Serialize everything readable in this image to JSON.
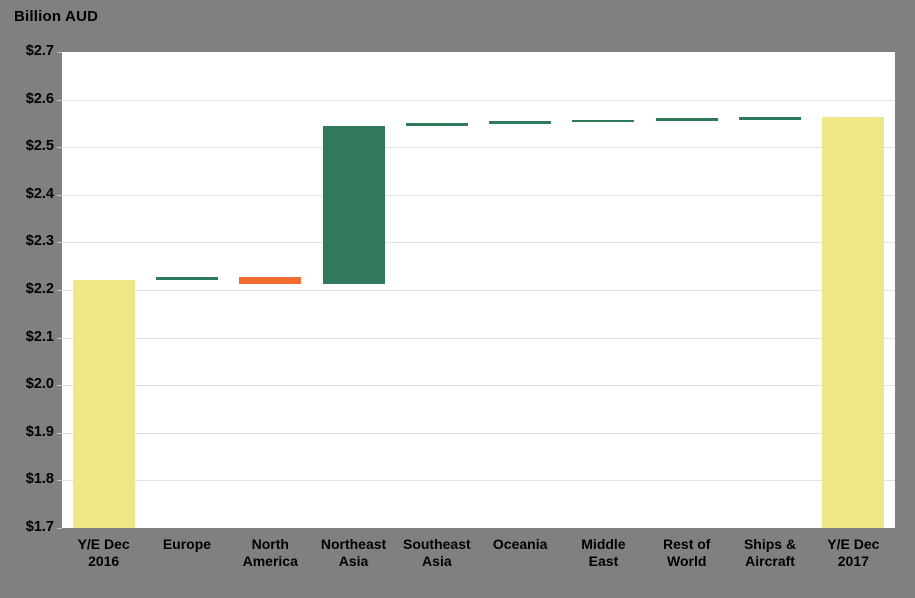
{
  "chart_data": {
    "type": "bar",
    "subtype": "waterfall",
    "title": "Billion AUD",
    "xlabel": "",
    "ylabel": "Billion AUD",
    "ylim": [
      1.7,
      2.7
    ],
    "ytick_step": 0.1,
    "grid": true,
    "legend": "none",
    "currency_prefix": "$",
    "categories": [
      "Y/E Dec\n2016",
      "Europe",
      "North\nAmerica",
      "Northeast\nAsia",
      "Southeast\nAsia",
      "Oceania",
      "Middle\nEast",
      "Rest of\nWorld",
      "Ships &\nAircraft",
      "Y/E Dec\n2017"
    ],
    "ytick_labels": [
      "$2.7",
      "$2.6",
      "$2.5",
      "$2.4",
      "$2.3",
      "$2.2",
      "$2.1",
      "$2.0",
      "$1.9",
      "$1.8",
      "$1.7"
    ],
    "ytick_values": [
      2.7,
      2.6,
      2.5,
      2.4,
      2.3,
      2.2,
      2.1,
      2.0,
      1.9,
      1.8,
      1.7
    ],
    "bars": [
      {
        "label": "Y/E Dec 2016",
        "kind": "total",
        "base": 1.7,
        "top": 2.22,
        "value": 2.22,
        "color": "#eee786"
      },
      {
        "label": "Europe",
        "kind": "increase",
        "base": 2.22,
        "top": 2.228,
        "value": 0.008,
        "color": "#31795c"
      },
      {
        "label": "North America",
        "kind": "decrease",
        "base": 2.228,
        "top": 2.212,
        "value": -0.016,
        "color": "#f26b31"
      },
      {
        "label": "Northeast Asia",
        "kind": "increase",
        "base": 2.212,
        "top": 2.545,
        "value": 0.333,
        "color": "#31795c"
      },
      {
        "label": "Southeast Asia",
        "kind": "increase",
        "base": 2.545,
        "top": 2.55,
        "value": 0.005,
        "color": "#31795c"
      },
      {
        "label": "Oceania",
        "kind": "increase",
        "base": 2.55,
        "top": 2.554,
        "value": 0.004,
        "color": "#31795c"
      },
      {
        "label": "Middle East",
        "kind": "increase",
        "base": 2.554,
        "top": 2.558,
        "value": 0.004,
        "color": "#31795c"
      },
      {
        "label": "Rest of World",
        "kind": "increase",
        "base": 2.558,
        "top": 2.561,
        "value": 0.003,
        "color": "#31795c"
      },
      {
        "label": "Ships & Aircraft",
        "kind": "increase",
        "base": 2.561,
        "top": 2.563,
        "value": 0.002,
        "color": "#31795c"
      },
      {
        "label": "Y/E Dec 2017",
        "kind": "total",
        "base": 1.7,
        "top": 2.563,
        "value": 2.563,
        "color": "#eee786"
      }
    ],
    "colors": {
      "background": "#808080",
      "plot_background": "#ffffff",
      "gridline": "#e2e2e2",
      "total_bar": "#eee786",
      "increase_bar": "#31795c",
      "decrease_bar": "#f26b31",
      "text": "#000000"
    }
  }
}
